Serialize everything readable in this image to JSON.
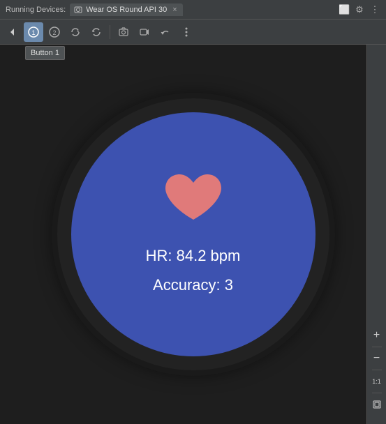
{
  "topbar": {
    "running_label": "Running Devices:",
    "tab_label": "Wear OS Round API 30",
    "close_label": "×"
  },
  "toolbar": {
    "buttons": [
      {
        "name": "back-button",
        "icon": "◀",
        "tooltip": null
      },
      {
        "name": "button1",
        "icon": "①",
        "tooltip": "Button 1"
      },
      {
        "name": "button2",
        "icon": "②",
        "tooltip": null
      },
      {
        "name": "button3",
        "icon": "⟳",
        "tooltip": null
      },
      {
        "name": "button4",
        "icon": "↻",
        "tooltip": null
      },
      {
        "name": "camera-button",
        "icon": "📷",
        "tooltip": null
      },
      {
        "name": "video-button",
        "icon": "🎥",
        "tooltip": null
      },
      {
        "name": "undo-button",
        "icon": "↩",
        "tooltip": null
      },
      {
        "name": "more-button",
        "icon": "⋮",
        "tooltip": null
      }
    ],
    "tooltip_text": "Button 1"
  },
  "watch": {
    "hr_label": "HR: 84.2 bpm",
    "accuracy_label": "Accuracy: 3",
    "heart_icon": "♥"
  },
  "right_controls": {
    "zoom_in": "+",
    "zoom_out": "−",
    "zoom_reset": "1:1",
    "fit_icon": "⊡"
  },
  "colors": {
    "watch_bg": "#3d52b0",
    "bezel_bg": "#222222",
    "heart_color": "#e07a7a",
    "toolbar_bg": "#3c3f41",
    "main_bg": "#1e1e1e"
  }
}
